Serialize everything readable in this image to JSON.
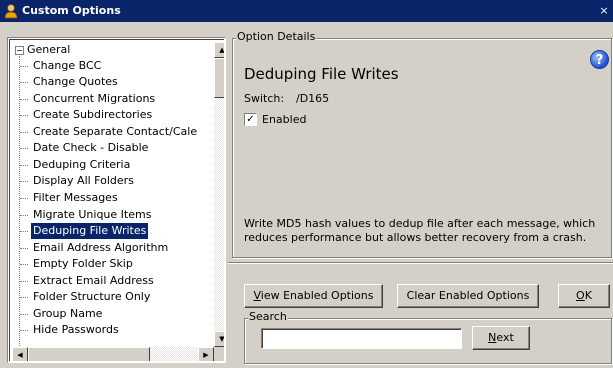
{
  "window": {
    "title": "Custom Options",
    "close_glyph": "×"
  },
  "tree": {
    "root_label": "General",
    "expander_glyph": "−",
    "items": [
      {
        "label": "Change BCC",
        "selected": false
      },
      {
        "label": "Change Quotes",
        "selected": false
      },
      {
        "label": "Concurrent Migrations",
        "selected": false
      },
      {
        "label": "Create Subdirectories",
        "selected": false
      },
      {
        "label": "Create Separate Contact/Cale",
        "selected": false
      },
      {
        "label": "Date Check - Disable",
        "selected": false
      },
      {
        "label": "Deduping Criteria",
        "selected": false
      },
      {
        "label": "Display All Folders",
        "selected": false
      },
      {
        "label": "Filter Messages",
        "selected": false
      },
      {
        "label": "Migrate Unique Items",
        "selected": false
      },
      {
        "label": "Deduping File Writes",
        "selected": true
      },
      {
        "label": "Email Address Algorithm",
        "selected": false
      },
      {
        "label": "Empty Folder Skip",
        "selected": false
      },
      {
        "label": "Extract Email Address",
        "selected": false
      },
      {
        "label": "Folder Structure Only",
        "selected": false
      },
      {
        "label": "Group Name",
        "selected": false
      },
      {
        "label": "Hide Passwords",
        "selected": false
      }
    ]
  },
  "details": {
    "legend": "Option Details",
    "heading": "Deduping File Writes",
    "switch_label": "Switch:",
    "switch_value": "/D165",
    "enabled_label": "Enabled",
    "enabled_checked": true,
    "check_glyph": "✓",
    "help_glyph": "?",
    "description": "Write MD5 hash values to dedup file after each message, which reduces performance but allows better recovery from a crash."
  },
  "buttons": {
    "view_enabled": {
      "mnemonic": "V",
      "rest": "iew Enabled Options"
    },
    "clear_enabled": "Clear Enabled Options",
    "ok": {
      "mnemonic": "O",
      "rest": "K"
    }
  },
  "search": {
    "legend": "Search",
    "value": "",
    "next": {
      "mnemonic": "N",
      "rest": "ext"
    }
  },
  "icons": {
    "window_icon": "person-icon",
    "help": "help-icon",
    "scroll_up": "arrow-up-icon",
    "scroll_down": "arrow-down-icon",
    "scroll_left": "arrow-left-icon",
    "scroll_right": "arrow-right-icon"
  },
  "colors": {
    "titlebar": "#0a246a",
    "selection": "#0a246a",
    "face": "#d4d0c8"
  }
}
